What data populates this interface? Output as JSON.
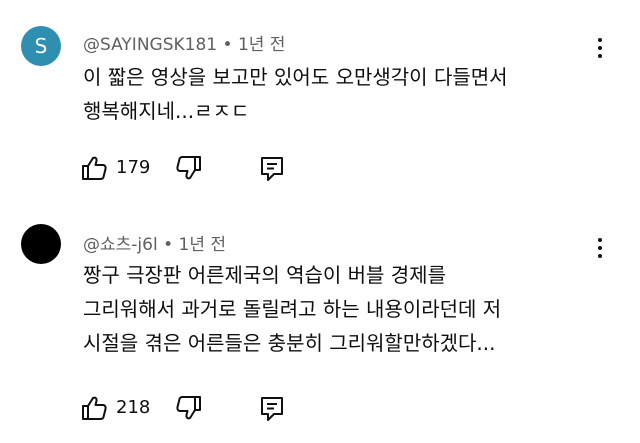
{
  "comments": [
    {
      "avatar_letter": "S",
      "avatar_color": "#2e8fb0",
      "author": "@SAYINGSK181",
      "separator": "•",
      "time": "1년 전",
      "lines": [
        "이 짧은 영상을 보고만 있어도 오만생각이 다들면서",
        "행복해지네...ㄹㅈㄷ"
      ],
      "likes": "179",
      "icons": {
        "like": "thumbs-up-icon",
        "dislike": "thumbs-down-icon",
        "reply": "reply-icon",
        "more": "more-vert-icon"
      }
    },
    {
      "avatar_letter": "",
      "avatar_color": "#000000",
      "author": "@쇼츠-j6l",
      "separator": "•",
      "time": "1년 전",
      "lines": [
        "짱구 극장판 어른제국의 역습이 버블 경제를",
        "그리워해서 과거로 돌릴려고 하는 내용이라던데 저",
        "시절을 겪은 어른들은 충분히 그리워할만하겠다..."
      ],
      "likes": "218",
      "icons": {
        "like": "thumbs-up-icon",
        "dislike": "thumbs-down-icon",
        "reply": "reply-icon",
        "more": "more-vert-icon"
      }
    }
  ]
}
